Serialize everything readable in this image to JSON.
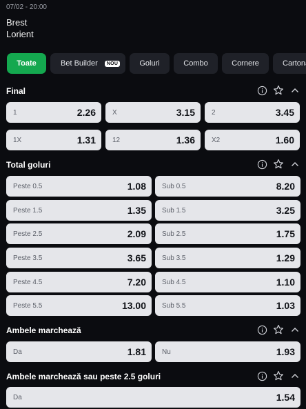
{
  "match": {
    "datetime": "07/02 - 20:00",
    "home": "Brest",
    "away": "Lorient"
  },
  "tabs": [
    {
      "label": "Toate",
      "active": true
    },
    {
      "label": "Bet Builder",
      "badge": "NOU"
    },
    {
      "label": "Goluri"
    },
    {
      "label": "Combo"
    },
    {
      "label": "Cornere"
    },
    {
      "label": "Cartona"
    }
  ],
  "sections": {
    "final": {
      "title": "Final",
      "odds": [
        {
          "label": "1",
          "value": "2.26"
        },
        {
          "label": "X",
          "value": "3.15"
        },
        {
          "label": "2",
          "value": "3.45"
        },
        {
          "label": "1X",
          "value": "1.31"
        },
        {
          "label": "12",
          "value": "1.36"
        },
        {
          "label": "X2",
          "value": "1.60"
        }
      ]
    },
    "total": {
      "title": "Total goluri",
      "odds": [
        {
          "label": "Peste 0.5",
          "value": "1.08"
        },
        {
          "label": "Sub 0.5",
          "value": "8.20"
        },
        {
          "label": "Peste 1.5",
          "value": "1.35"
        },
        {
          "label": "Sub 1.5",
          "value": "3.25"
        },
        {
          "label": "Peste 2.5",
          "value": "2.09"
        },
        {
          "label": "Sub 2.5",
          "value": "1.75"
        },
        {
          "label": "Peste 3.5",
          "value": "3.65"
        },
        {
          "label": "Sub 3.5",
          "value": "1.29"
        },
        {
          "label": "Peste 4.5",
          "value": "7.20"
        },
        {
          "label": "Sub 4.5",
          "value": "1.10"
        },
        {
          "label": "Peste 5.5",
          "value": "13.00"
        },
        {
          "label": "Sub 5.5",
          "value": "1.03"
        }
      ]
    },
    "btts": {
      "title": "Ambele marchează",
      "odds": [
        {
          "label": "Da",
          "value": "1.81"
        },
        {
          "label": "Nu",
          "value": "1.93"
        }
      ]
    },
    "btts_over": {
      "title": "Ambele marchează sau peste 2.5 goluri",
      "odds": [
        {
          "label": "Da",
          "value": "1.54"
        }
      ]
    }
  },
  "icons": [
    "info-icon",
    "star-icon",
    "chevron-up-icon"
  ],
  "colors": {
    "background": "#0b0c10",
    "active_tab": "#14a84f",
    "tab": "#1f2128",
    "odd_button": "#e5e6ea"
  }
}
